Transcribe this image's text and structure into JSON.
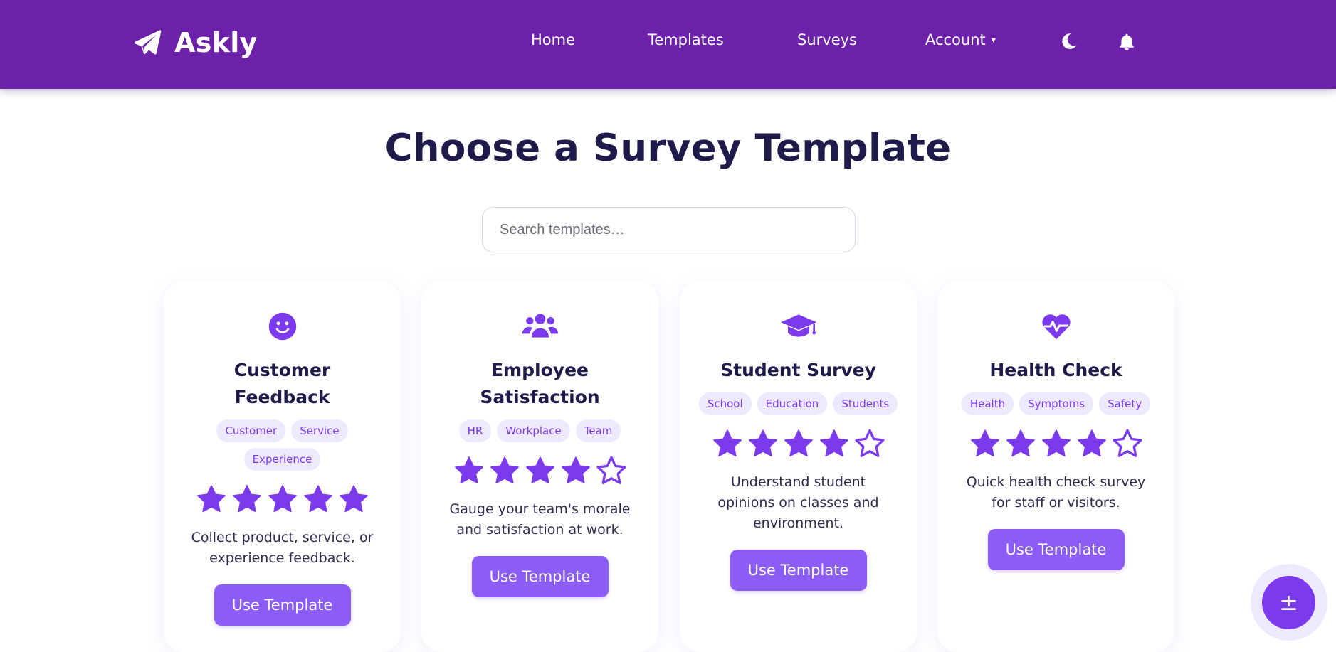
{
  "app": {
    "name": "Askly",
    "logo_icon": "paper-plane-icon"
  },
  "nav": {
    "home": "Home",
    "templates": "Templates",
    "surveys": "Surveys",
    "account": "Account",
    "caret": "▾",
    "theme_icon": "moon-icon",
    "notifications_icon": "bell-icon"
  },
  "page": {
    "title": "Choose a Survey Template",
    "search_placeholder": "Search templates…"
  },
  "colors": {
    "header_bg": "#6b21a8",
    "accent": "#7c3aed",
    "button": "#8b5cf6",
    "tag_bg": "#ede9fe",
    "heading": "#1e1b4b"
  },
  "templates": [
    {
      "icon": "smile-icon",
      "title": "Customer Feedback",
      "tags": [
        "Customer",
        "Service",
        "Experience"
      ],
      "rating": 5,
      "max_rating": 5,
      "description": "Collect product, service, or experience feedback.",
      "button": "Use Template"
    },
    {
      "icon": "users-icon",
      "title": "Employee Satisfaction",
      "tags": [
        "HR",
        "Workplace",
        "Team"
      ],
      "rating": 4,
      "max_rating": 5,
      "description": "Gauge your team's morale and satisfaction at work.",
      "button": "Use Template"
    },
    {
      "icon": "graduation-cap-icon",
      "title": "Student Survey",
      "tags": [
        "School",
        "Education",
        "Students"
      ],
      "rating": 4,
      "max_rating": 5,
      "description": "Understand student opinions on classes and environment.",
      "button": "Use Template"
    },
    {
      "icon": "heartbeat-icon",
      "title": "Health Check",
      "tags": [
        "Health",
        "Symptoms",
        "Safety"
      ],
      "rating": 4,
      "max_rating": 5,
      "description": "Quick health check survey for staff or visitors.",
      "button": "Use Template"
    }
  ],
  "fab": {
    "label": "±"
  }
}
